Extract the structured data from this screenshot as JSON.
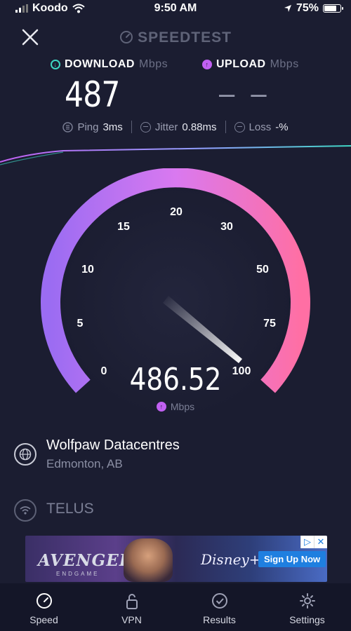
{
  "status_bar": {
    "carrier": "Koodo",
    "time": "9:50 AM",
    "battery": "75%"
  },
  "header": {
    "title": "SPEEDTEST"
  },
  "download": {
    "label": "DOWNLOAD",
    "unit": "Mbps",
    "value": "487"
  },
  "upload": {
    "label": "UPLOAD",
    "unit": "Mbps",
    "value": "– –"
  },
  "stats": {
    "ping_label": "Ping",
    "ping_value": "3ms",
    "jitter_label": "Jitter",
    "jitter_value": "0.88ms",
    "loss_label": "Loss",
    "loss_value": "-%"
  },
  "gauge": {
    "ticks": [
      "0",
      "5",
      "10",
      "15",
      "20",
      "30",
      "50",
      "75",
      "100"
    ],
    "reading": "486.52",
    "unit": "Mbps"
  },
  "server": {
    "name": "Wolfpaw Datacentres",
    "location": "Edmonton, AB"
  },
  "isp": {
    "name": "TELUS"
  },
  "ad": {
    "brand": "AVENGERS",
    "brand_sub": "ENDGAME",
    "partner": "Disney+",
    "cta": "Sign Up Now"
  },
  "tabs": [
    {
      "label": "Speed",
      "icon": "speed-icon"
    },
    {
      "label": "VPN",
      "icon": "lock-icon"
    },
    {
      "label": "Results",
      "icon": "check-circle-icon"
    },
    {
      "label": "Settings",
      "icon": "gear-icon"
    }
  ],
  "colors": {
    "background": "#1b1d31",
    "download_accent": "#3ed6c3",
    "upload_accent": "#c160f2",
    "gauge_start": "#9b6cf2",
    "gauge_end": "#ff6fa4"
  }
}
